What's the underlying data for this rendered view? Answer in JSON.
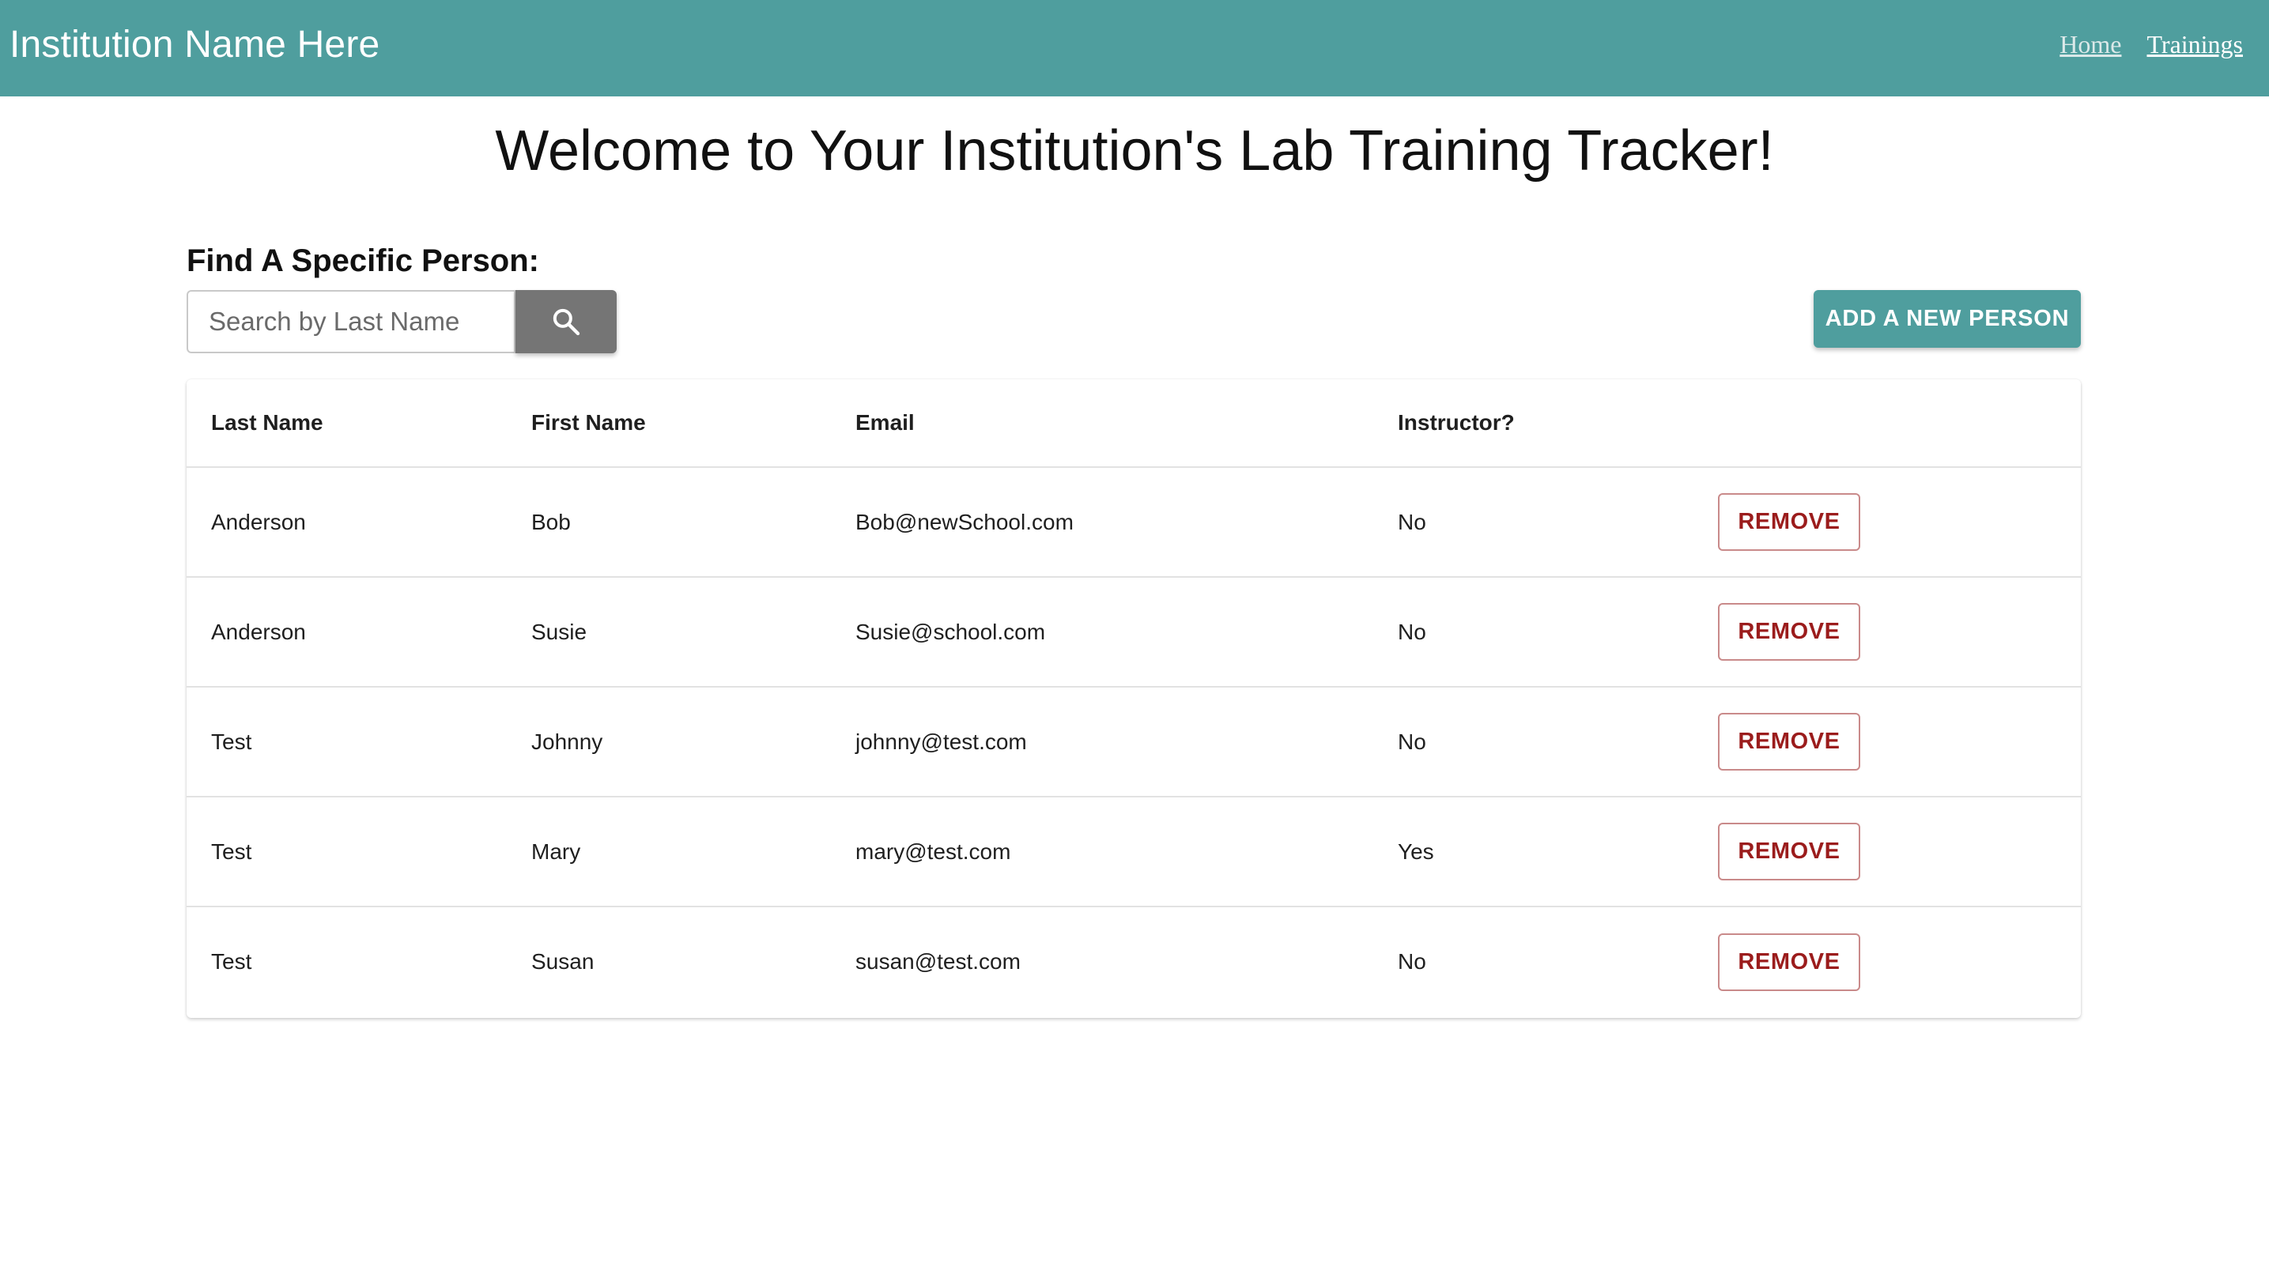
{
  "header": {
    "brand": "Institution Name Here",
    "nav": {
      "home": "Home",
      "trainings": "Trainings"
    }
  },
  "page_title": "Welcome to Your Institution's Lab Training Tracker!",
  "search": {
    "label": "Find A Specific Person:",
    "placeholder": "Search by Last Name",
    "value": "",
    "button_icon": "search-icon"
  },
  "actions": {
    "add_person": "ADD A NEW PERSON"
  },
  "table": {
    "columns": {
      "last_name": "Last Name",
      "first_name": "First Name",
      "email": "Email",
      "instructor": "Instructor?"
    },
    "rows": [
      {
        "last_name": "Anderson",
        "first_name": "Bob",
        "email": "Bob@newSchool.com",
        "instructor": "No",
        "action": "REMOVE"
      },
      {
        "last_name": "Anderson",
        "first_name": "Susie",
        "email": "Susie@school.com",
        "instructor": "No",
        "action": "REMOVE"
      },
      {
        "last_name": "Test",
        "first_name": "Johnny",
        "email": "johnny@test.com",
        "instructor": "No",
        "action": "REMOVE"
      },
      {
        "last_name": "Test",
        "first_name": "Mary",
        "email": "mary@test.com",
        "instructor": "Yes",
        "action": "REMOVE"
      },
      {
        "last_name": "Test",
        "first_name": "Susan",
        "email": "susan@test.com",
        "instructor": "No",
        "action": "REMOVE"
      }
    ]
  },
  "colors": {
    "header_bg": "#4f9e9e",
    "primary_button": "#4f9e9e",
    "search_button": "#757575",
    "remove_text": "#9b1c1c"
  }
}
